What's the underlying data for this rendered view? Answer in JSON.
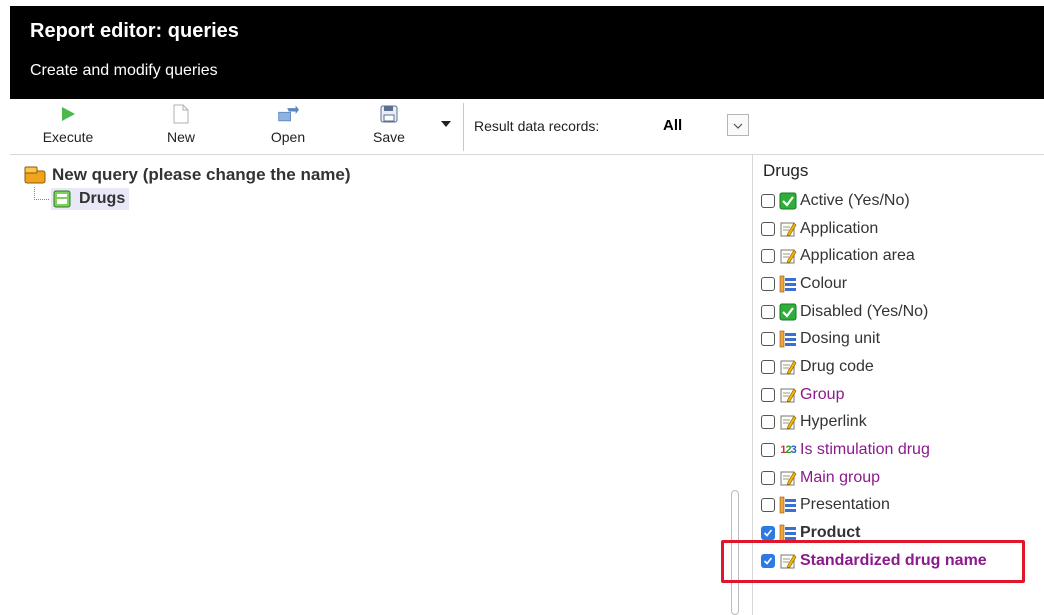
{
  "header": {
    "title": "Report editor: queries",
    "subtitle": "Create and modify queries"
  },
  "toolbar": {
    "execute_label": "Execute",
    "new_label": "New",
    "open_label": "Open",
    "save_label": "Save",
    "result_label": "Result data records:",
    "result_value": "All"
  },
  "tree": {
    "root_label": "New query (please change the name)",
    "child_label": "Drugs"
  },
  "fields_panel": {
    "title": "Drugs",
    "items": [
      {
        "label": "Active (Yes/No)",
        "icon": "boolean-check-icon",
        "checked": false,
        "style": "normal"
      },
      {
        "label": "Application",
        "icon": "text-edit-icon",
        "checked": false,
        "style": "normal"
      },
      {
        "label": "Application area",
        "icon": "text-edit-icon",
        "checked": false,
        "style": "normal"
      },
      {
        "label": "Colour",
        "icon": "list-icon",
        "checked": false,
        "style": "normal"
      },
      {
        "label": "Disabled (Yes/No)",
        "icon": "boolean-check-icon",
        "checked": false,
        "style": "normal"
      },
      {
        "label": "Dosing unit",
        "icon": "list-icon",
        "checked": false,
        "style": "normal"
      },
      {
        "label": "Drug code",
        "icon": "text-edit-icon",
        "checked": false,
        "style": "normal"
      },
      {
        "label": "Group",
        "icon": "text-edit-icon",
        "checked": false,
        "style": "purple"
      },
      {
        "label": "Hyperlink",
        "icon": "text-edit-icon",
        "checked": false,
        "style": "normal"
      },
      {
        "label": "Is stimulation drug",
        "icon": "number-123-icon",
        "checked": false,
        "style": "purple"
      },
      {
        "label": "Main group",
        "icon": "text-edit-icon",
        "checked": false,
        "style": "purple"
      },
      {
        "label": "Presentation",
        "icon": "list-icon",
        "checked": false,
        "style": "normal"
      },
      {
        "label": "Product",
        "icon": "list-icon",
        "checked": true,
        "style": "bold"
      },
      {
        "label": "Standardized drug name",
        "icon": "text-edit-icon",
        "checked": true,
        "style": "bold-purple"
      }
    ]
  },
  "colors": {
    "header_bg": "#000000",
    "accent_blue": "#2c7be5",
    "purple_text": "#8b1a8b",
    "highlight_red": "#e0162b"
  }
}
